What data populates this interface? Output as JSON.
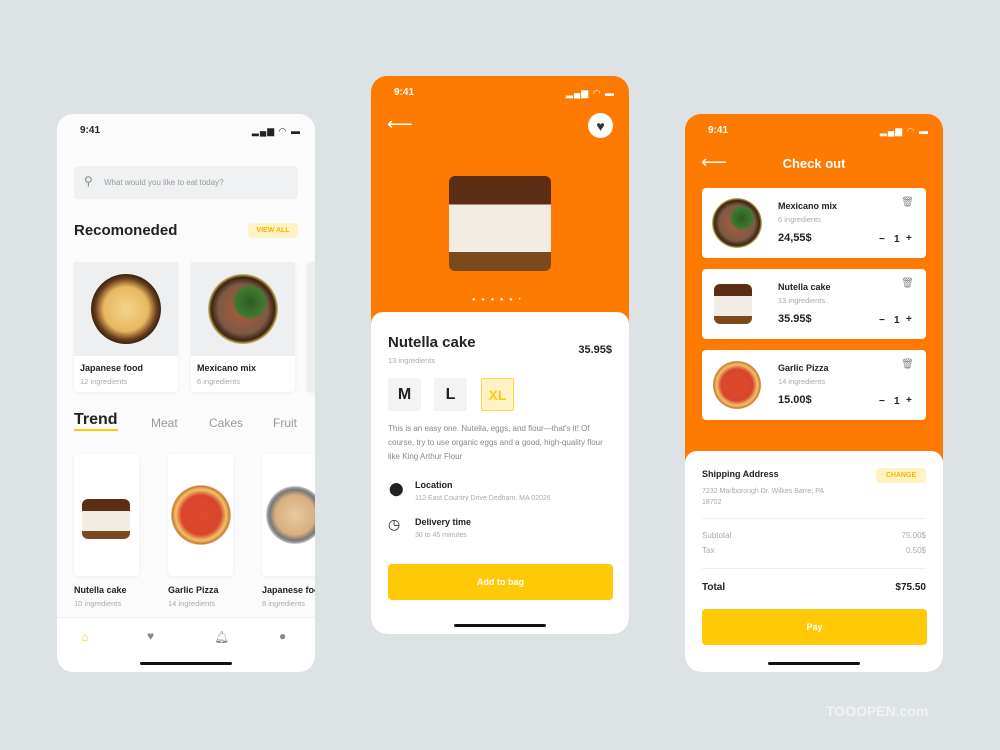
{
  "status_time": "9:41",
  "home": {
    "search_placeholder": "What would you like to eat today?",
    "section_title": "Recomoneded",
    "view_all": "VIEW ALL",
    "recommended": [
      {
        "name": "Japanese food",
        "sub": "12 ingredients"
      },
      {
        "name": "Mexicano mix",
        "sub": "6 ingredients"
      }
    ],
    "tabs": [
      "Trend",
      "Meat",
      "Cakes",
      "Fruit"
    ],
    "trend": [
      {
        "name": "Nutella cake",
        "sub": "10 ingredients"
      },
      {
        "name": "Garlic Pizza",
        "sub": "14 ingredients"
      },
      {
        "name": "Japanese food",
        "sub": "8 ingredients"
      }
    ],
    "nav": [
      "home-icon",
      "heart-icon",
      "bell-icon",
      "user-icon"
    ]
  },
  "detail": {
    "title": "Nutella cake",
    "sub": "13 ingredients",
    "price": "35.95$",
    "sizes": [
      "M",
      "L",
      "XL"
    ],
    "selected_size": "XL",
    "description": "This is an easy one. Nutella, eggs, and flour—that's it! Of course, try to use organic eggs and a good, high-quality flour like King Arthur Flour",
    "location_label": "Location",
    "location_value": "112 East Country Drive Dedham, MA 02026",
    "delivery_label": "Delivery time",
    "delivery_value": "30 to 45 minutes",
    "add_button": "Add to bag"
  },
  "checkout": {
    "title": "Check out",
    "items": [
      {
        "name": "Mexicano mix",
        "sub": "6 ingredients",
        "price": "24,55$",
        "qty": "1"
      },
      {
        "name": "Nutella cake",
        "sub": "13 ingredients",
        "price": "35.95$",
        "qty": "1"
      },
      {
        "name": "Garlic Pizza",
        "sub": "14 ingredients",
        "price": "15.00$",
        "qty": "1"
      }
    ],
    "shipping_label": "Shipping Address",
    "change": "CHANGE",
    "address": "7232 Marlborough Dr. Wilkes Barre, PA 18702",
    "subtotal_label": "Subtotal",
    "subtotal": "75.00$",
    "tax_label": "Tax",
    "tax": "0.50$",
    "total_label": "Total",
    "total": "$75.50",
    "pay": "Pay"
  },
  "colors": {
    "orange": "#ff7a00",
    "yellow": "#ffc907",
    "background": "#dde2e5"
  },
  "watermark": "TOOOPEN.com"
}
